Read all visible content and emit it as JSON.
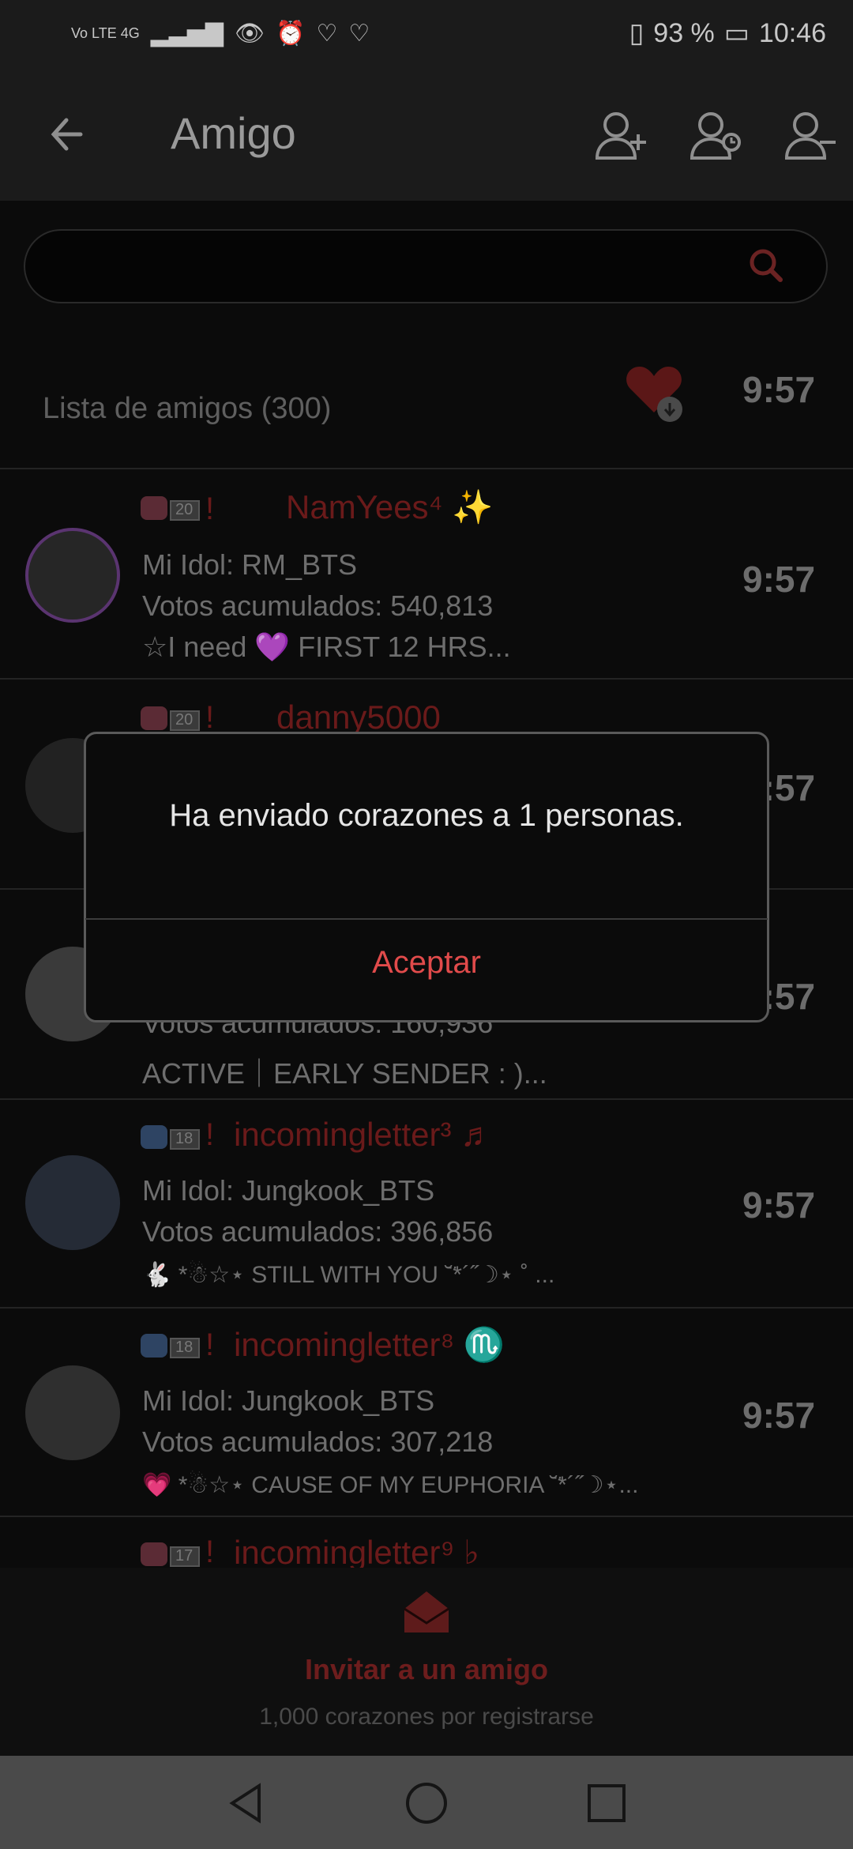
{
  "status": {
    "network": "Vo LTE 4G",
    "battery": "93 %",
    "time": "10:46"
  },
  "header": {
    "title": "Amigo",
    "actions": [
      "add-friend-icon",
      "friend-requests-icon",
      "remove-friend-icon"
    ]
  },
  "search": {
    "placeholder": ""
  },
  "friends": {
    "label": "Lista de amigos (300)",
    "time": "9:57"
  },
  "rows": [
    {
      "badge": "20",
      "name": "NamYees⁴ ✨",
      "idol": "Mi Idol: RM_BTS",
      "votes": "Votos acumulados: 540,813",
      "status": "☆I need 💜  FIRST 12 HRS...",
      "time": "9:57"
    },
    {
      "badge": "20",
      "name": "danny5000",
      "time": "9:57"
    },
    {
      "votes": "Votos acumulados: 160,936",
      "status": "ACTIVE｜EARLY SENDER : )...",
      "time": "9:57"
    },
    {
      "badge": "18",
      "name": "incomingletter³ ♬",
      "idol": "Mi Idol: Jungkook_BTS",
      "votes": "Votos acumulados: 396,856",
      "status": "🐇 *☃☆⋆ STILL WITH YOU ˘̈*´˝☽⋆ ˚ ...",
      "time": "9:57"
    },
    {
      "badge": "18",
      "name": "incomingletter⁸ ♏",
      "idol": "Mi Idol: Jungkook_BTS",
      "votes": "Votos acumulados: 307,218",
      "status": "💗 *☃☆⋆ CAUSE OF MY EUPHORIA ˘̈*´˝☽⋆...",
      "time": "9:57"
    },
    {
      "badge": "17",
      "name": "incomingletter⁹ ♭"
    }
  ],
  "footer": {
    "invite": "Invitar a un amigo",
    "registration": "1,000 corazones por registrarse"
  },
  "dialog": {
    "message": "Ha enviado corazones a 1 personas.",
    "accept": "Aceptar"
  }
}
